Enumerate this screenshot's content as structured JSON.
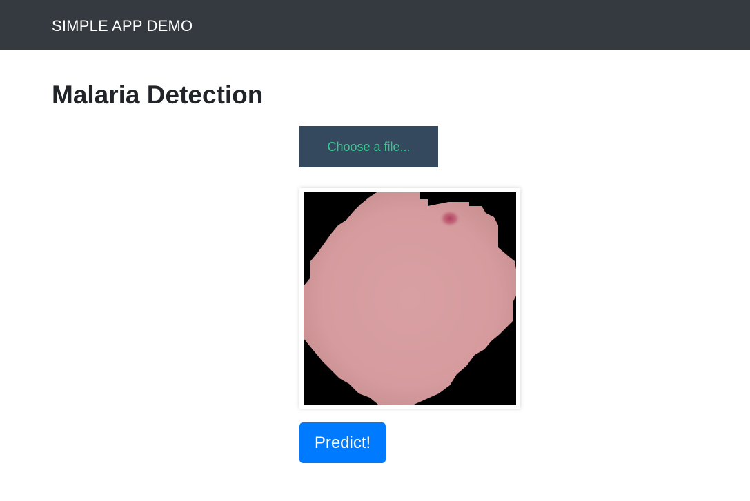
{
  "navbar": {
    "brand": "SIMPLE APP DEMO",
    "background": "#343a40"
  },
  "page": {
    "title": "Malaria Detection"
  },
  "file_input": {
    "label": "Choose a file...",
    "background": "#34495e",
    "text_color": "#39c88f"
  },
  "preview": {
    "subject": "blood cell image",
    "cell_color": "#d79c9e",
    "background_color": "#000000",
    "spot_color": "#b84a66"
  },
  "predict": {
    "label": "Predict!",
    "background": "#007bff"
  }
}
